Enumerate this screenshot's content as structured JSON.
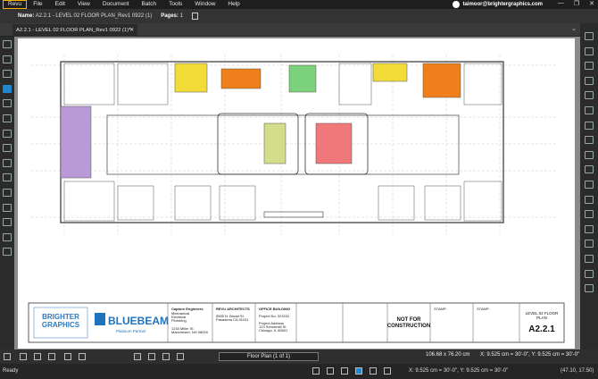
{
  "menu": {
    "items": [
      "Revu",
      "File",
      "Edit",
      "View",
      "Document",
      "Batch",
      "Tools",
      "Window",
      "Help"
    ]
  },
  "user": {
    "email": "taimoor@brightergraphics.com"
  },
  "properties": {
    "name_label": "Name:",
    "name_value": "A2.2.1 - LEVEL 02 FLOOR PLAN_Rev1 0922 (1)",
    "pages_label": "Pages:",
    "pages_value": "1"
  },
  "tab": {
    "title": "A2.2.1 - LEVEL 02 FLOOR PLAN_Rev1 0922 (1)*",
    "close": "✕"
  },
  "bottom": {
    "page_nav": "Floor Plan (1 of 1)",
    "dimensions": "106.68 x 76.20 cm",
    "scale": "X: 9.525 cm = 30'-0\", Y: 9.525 cm = 30'-0\""
  },
  "status": {
    "ready": "Ready",
    "scale": "X: 9.525 cm = 30'-0\", Y: 9.525 cm = 30'-0\"",
    "zoom": "(47.10, 17.50)"
  },
  "titleblock": {
    "brand1_a": "BRIGHTER",
    "brand1_b": "GRAPHICS",
    "brand2": "BLUEBEAM",
    "brand2_sub": "Platinum Partner",
    "consultant_title": "Capture Engineers",
    "consultant_lines": [
      "Mechanical",
      "Electrical",
      "Plumbing"
    ],
    "consultant_addr": "1234 Miller St.",
    "consultant_city": "Manchester, NH 08000",
    "architect_title": "REVU ARCHITECTS",
    "architect_addr": "5555 N. Broad St",
    "architect_city": "Pasadena CA 91101",
    "project_title": "OFFICE BUILDING",
    "project_no": "Project No. 323232",
    "project_addr_label": "Project Address",
    "project_addr": "123 Schoenstt St",
    "project_city": "Chicago, IL 60601",
    "nfc_line1": "NOT FOR",
    "nfc_line2": "CONSTRUCTION",
    "stamp1": "STAMP:",
    "stamp2": "STAMP:",
    "sheet_title_line1": "LEVEL 02 FLOOR",
    "sheet_title_line2": "PLAN",
    "sheet_number": "A2.2.1"
  }
}
